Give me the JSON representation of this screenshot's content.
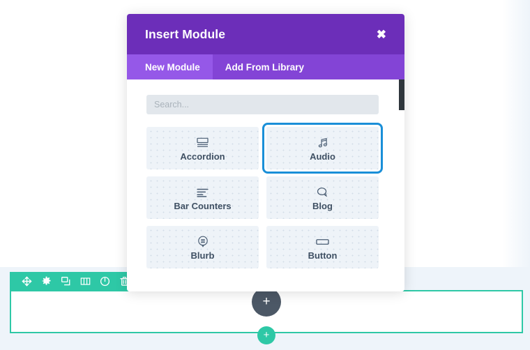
{
  "modal": {
    "title": "Insert Module",
    "close_label": "✖",
    "tabs": [
      {
        "label": "New Module",
        "active": true
      },
      {
        "label": "Add From Library",
        "active": false
      }
    ],
    "search": {
      "value": "",
      "placeholder": "Search..."
    },
    "modules": [
      {
        "label": "Accordion",
        "icon": "accordion-icon",
        "focused": false
      },
      {
        "label": "Audio",
        "icon": "audio-note-icon",
        "focused": true
      },
      {
        "label": "Bar Counters",
        "icon": "bar-counters-icon",
        "focused": false
      },
      {
        "label": "Blog",
        "icon": "blog-bubble-icon",
        "focused": false
      },
      {
        "label": "Blurb",
        "icon": "blurb-icon",
        "focused": false
      },
      {
        "label": "Button",
        "icon": "button-icon",
        "focused": false
      }
    ]
  },
  "row_toolbar": {
    "buttons": [
      {
        "name": "move-row-button",
        "icon": "move-arrows-icon"
      },
      {
        "name": "row-settings-button",
        "icon": "gear-icon"
      },
      {
        "name": "duplicate-row-button",
        "icon": "duplicate-icon"
      },
      {
        "name": "column-layout-button",
        "icon": "columns-icon"
      },
      {
        "name": "disable-row-button",
        "icon": "power-icon"
      },
      {
        "name": "delete-row-button",
        "icon": "trash-icon"
      }
    ]
  },
  "canvas": {
    "add_module_label": "+",
    "add_row_label": "+"
  },
  "colors": {
    "modal_header_purple": "#6c2eb9",
    "tab_bar_purple": "#8344d6",
    "tab_active_purple": "#9558e8",
    "row_accent_teal": "#2ec8a6",
    "focus_ring_blue": "#1a8fd8",
    "add_module_dark": "#4c5866",
    "card_background": "#eef3f8",
    "search_background": "#e2e7ec"
  }
}
